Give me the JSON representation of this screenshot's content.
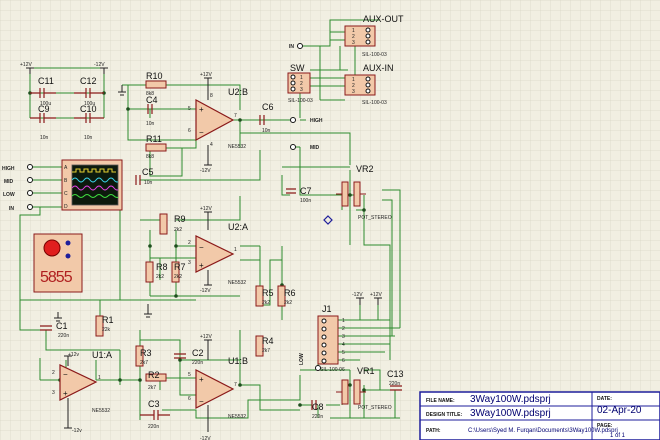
{
  "colors": {
    "background": "#f1efe2",
    "grid": "#d8d6c6",
    "wire": "#2d8b2d",
    "component": "#8b1a1a",
    "body_fill": "#f2c9a9",
    "frame": "#1e1e9b",
    "text": "#111111"
  },
  "rails": {
    "pos": "+12V",
    "neg": "-12V",
    "posl": "+12v",
    "negl": "-12v"
  },
  "inputs": {
    "high": "HIGH",
    "mid": "MID",
    "low": "LOW",
    "in": "IN"
  },
  "outputs": {
    "high": "HIGH",
    "mid": "MID",
    "low": "LOW",
    "in": "IN"
  },
  "opamps": {
    "u2b": {
      "ref": "U2:B",
      "part": "NE5532",
      "p8": "8",
      "p5": "5",
      "p6": "6",
      "p7": "7",
      "p4": "4"
    },
    "u2a": {
      "ref": "U2:A",
      "part": "NE5532",
      "p2": "2",
      "p3": "3",
      "p1": "1"
    },
    "u1b": {
      "ref": "U1:B",
      "part": "NE5532",
      "p5": "5",
      "p6": "6",
      "p7": "7"
    },
    "u1a": {
      "ref": "U1:A",
      "part": "NE5532",
      "p2": "2",
      "p3": "3",
      "p1": "1"
    }
  },
  "components": {
    "c11": {
      "ref": "C11",
      "val": "100u"
    },
    "c12": {
      "ref": "C12",
      "val": "100u"
    },
    "c9": {
      "ref": "C9",
      "val": "10n"
    },
    "c10": {
      "ref": "C10",
      "val": "10n"
    },
    "r10": {
      "ref": "R10",
      "val": "8k8"
    },
    "c4": {
      "ref": "C4",
      "val": "10n"
    },
    "r11": {
      "ref": "R11",
      "val": "8k8"
    },
    "c5": {
      "ref": "C5",
      "val": "10n"
    },
    "c6": {
      "ref": "C6",
      "val": "10n"
    },
    "c7": {
      "ref": "C7",
      "val": "100n"
    },
    "r9": {
      "ref": "R9",
      "val": "2k2"
    },
    "r8": {
      "ref": "R8",
      "val": "2k2"
    },
    "r7": {
      "ref": "R7",
      "val": "2k2"
    },
    "r5": {
      "ref": "R5",
      "val": "2k2"
    },
    "r6": {
      "ref": "R6",
      "val": "2k2"
    },
    "c1": {
      "ref": "C1",
      "val": "220n"
    },
    "r1": {
      "ref": "R1",
      "val": "22k"
    },
    "r3": {
      "ref": "R3",
      "val": "2k7"
    },
    "c2": {
      "ref": "C2",
      "val": "220n"
    },
    "r4": {
      "ref": "R4",
      "val": "2k7"
    },
    "r2": {
      "ref": "R2",
      "val": "2k7"
    },
    "c3": {
      "ref": "C3",
      "val": "220n"
    },
    "c8": {
      "ref": "C8",
      "val": "220n"
    },
    "c13": {
      "ref": "C13",
      "val": "220n"
    },
    "vr2": {
      "ref": "VR2",
      "val": "POT_STEREO"
    },
    "vr1": {
      "ref": "VR1",
      "val": "POT_STEREO"
    }
  },
  "connectors": {
    "aux_out": {
      "ref": "AUX-OUT",
      "part": "SIL-100-03",
      "p1": "1",
      "p2": "2",
      "p3": "3"
    },
    "aux_in": {
      "ref": "AUX-IN",
      "part": "SIL-100-03",
      "p1": "1",
      "p2": "2",
      "p3": "3"
    },
    "sw": {
      "ref": "SW",
      "part": "SIL-100-03",
      "p1": "1",
      "p2": "2",
      "p3": "3"
    },
    "j1": {
      "ref": "J1",
      "part": "SIL-100-06",
      "p1": "1",
      "p2": "2",
      "p3": "3",
      "p4": "4",
      "p5": "5",
      "p6": "6"
    }
  },
  "scope": {
    "channels": [
      "A",
      "B",
      "C",
      "D"
    ]
  },
  "counter": {
    "digits": "5855"
  },
  "title_block": {
    "file_name_label": "FILE NAME:",
    "file_name": "3Way100W.pdsprj",
    "design_title_label": "DESIGN TITLE:",
    "design_title": "3Way100W.pdsprj",
    "path_label": "PATH:",
    "path": "C:\\Users\\Syed M. Furqan\\Documents\\3Way100W.pdsprj",
    "date_label": "DATE:",
    "date": "02-Apr-20",
    "page_label": "PAGE:",
    "page": "1 of 1"
  }
}
